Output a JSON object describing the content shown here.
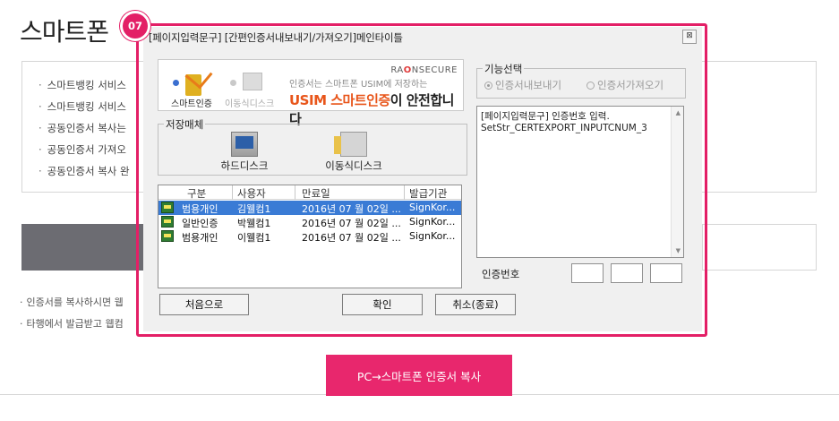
{
  "page": {
    "title": "스마트폰",
    "info_items": [
      "스마트뱅킹 서비스",
      "스마트뱅킹 서비스",
      "공동인증서 복사는",
      "공동인증서 가져오",
      "공동인증서 복사 완"
    ],
    "notes": [
      "인증서를 복사하시면 웹",
      "타행에서 발급받고 웹컴"
    ],
    "copy_button": "PC→스마트폰 인증서 복사"
  },
  "badge": "07",
  "dialog": {
    "title": "[페이지입력문구] [간편인증서내보내기/가져오기]메인타이틀",
    "close": "⊠",
    "banner": {
      "brand_a": "RA",
      "brand_o": "O",
      "brand_b": "N",
      "brand_rest": "SECURE",
      "sub": "인증서는 스마트폰 USIM에 저장하는",
      "main_accent": "USIM 스마트인증",
      "main_rest": "이 안전합니다",
      "opt_smart": "스마트인증",
      "opt_move": "이동식디스크"
    },
    "storage": {
      "legend": "저장매체",
      "hdd": "하드디스크",
      "removable": "이동식디스크"
    },
    "list": {
      "headers": [
        "구분",
        "사용자",
        "만료일",
        "발급기관"
      ],
      "rows": [
        {
          "type": "범용개인",
          "user": "김웰컴1",
          "expiry": "2016년 07 월 02일 ...",
          "issuer": "SignKor..."
        },
        {
          "type": "일반인증",
          "user": "박웰컴1",
          "expiry": "2016년 07 월 02일 ...",
          "issuer": "SignKor..."
        },
        {
          "type": "범용개인",
          "user": "이웰컴1",
          "expiry": "2016년 07 월 02일 ...",
          "issuer": "SignKor..."
        }
      ],
      "selected_index": 0
    },
    "function": {
      "legend": "기능선택",
      "export": "인증서내보내기",
      "import": "인증서가져오기"
    },
    "log": {
      "line1": "[페이지입력문구] 인증번호 입력.",
      "line2": "SetStr_CERTEXPORT_INPUTCNUM_3"
    },
    "auth_label": "인증번호",
    "buttons": {
      "first": "처음으로",
      "ok": "확인",
      "cancel": "취소(종료)"
    }
  },
  "colors": {
    "accent": "#e31f66",
    "selection": "#3a7bd5"
  }
}
